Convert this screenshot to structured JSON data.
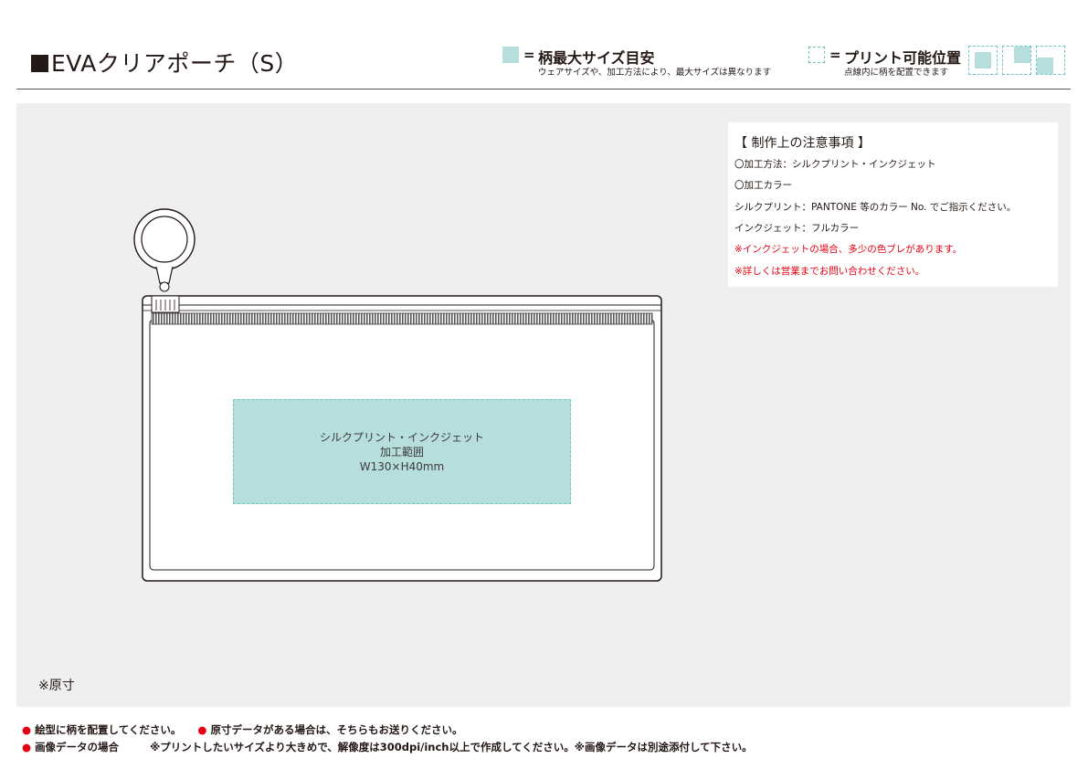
{
  "header": {
    "title": "EVAクリアポーチ（S）",
    "legend_equals": "=",
    "pattern_legend_title": "柄最大サイズ目安",
    "pattern_legend_sub": "ウェアサイズや、加工方法により、最大サイズは異なります",
    "print_legend_title": "プリント可能位置",
    "print_legend_sub": "点線内に柄を配置できます"
  },
  "notes": {
    "heading": "【 制作上の注意事項 】",
    "lines": [
      "〇加工方法：シルクプリント・インクジェット",
      "〇加工カラー",
      "シルクプリント：PANTONE 等のカラー No. でご指示ください。",
      "インクジェット：フルカラー"
    ],
    "red_lines": [
      "※インクジェットの場合、多少の色ブレがあります。",
      "※詳しくは営業までお問い合わせください。"
    ]
  },
  "print_area": {
    "line1": "シルクプリント・インクジェット",
    "line2": "加工範囲",
    "line3": "W130×H40mm"
  },
  "scale_note": "※原寸",
  "footer": {
    "bullet": "●",
    "line1_a": "絵型に柄を配置してください。",
    "line1_b": "原寸データがある場合は、そちらもお送りください。",
    "line2_a": "画像データの場合",
    "line2_b": "※プリントしたいサイズより大きめで、解像度は300dpi/inch以上で作成してください。※画像データは別途添付して下さい。"
  },
  "colors": {
    "print_area_fill": "#b5dedd",
    "dashed_outline": "#6ec5c3",
    "warning_red": "#e60012",
    "background_grey": "#efefef"
  }
}
